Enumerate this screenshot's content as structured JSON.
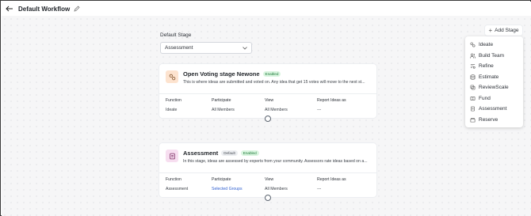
{
  "header": {
    "title": "Default Workflow"
  },
  "workflow": {
    "default_stage_label": "Default Stage",
    "default_stage_value": "Assessment"
  },
  "add_stage": {
    "label": "Add Stage",
    "menu": [
      {
        "label": "Ideate",
        "icon": "ideate-icon"
      },
      {
        "label": "Build Team",
        "icon": "team-icon"
      },
      {
        "label": "Refine",
        "icon": "refine-icon"
      },
      {
        "label": "Estimate",
        "icon": "estimate-icon"
      },
      {
        "label": "ReviewScale",
        "icon": "review-icon"
      },
      {
        "label": "Fund",
        "icon": "fund-icon"
      },
      {
        "label": "Assessment",
        "icon": "assessment-icon"
      },
      {
        "label": "Reserve",
        "icon": "reserve-icon"
      }
    ]
  },
  "stages": [
    {
      "title": "Open Voting stage Newone",
      "badges": [
        "Enabled"
      ],
      "description": "This is where ideas are submitted and voted on. Any idea that get 15 votes will move to the next st...",
      "columns": {
        "function": {
          "header": "Function",
          "value": "Ideate"
        },
        "participate": {
          "header": "Participate",
          "value": "All Members"
        },
        "view": {
          "header": "View",
          "value": "All Members"
        },
        "report": {
          "header": "Report Ideas as",
          "value": "---"
        }
      }
    },
    {
      "title": "Assessment",
      "badges": [
        "Default",
        "Enabled"
      ],
      "description": "In this stage, ideas are assessed by experts from your community. Assessors rate ideas based on a...",
      "columns": {
        "function": {
          "header": "Function",
          "value": "Assessment"
        },
        "participate": {
          "header": "Participate",
          "value": "Selected Groups"
        },
        "view": {
          "header": "View",
          "value": "All Members"
        },
        "report": {
          "header": "Report Ideas as",
          "value": "---"
        }
      }
    }
  ],
  "colors": {
    "accent_link": "#2f5fd0",
    "enabled_badge_bg": "#daf5e0",
    "enabled_badge_text": "#1f7a3a",
    "ideate_icon_bg": "#fde3cf",
    "assessment_icon_bg": "#f7def0"
  }
}
